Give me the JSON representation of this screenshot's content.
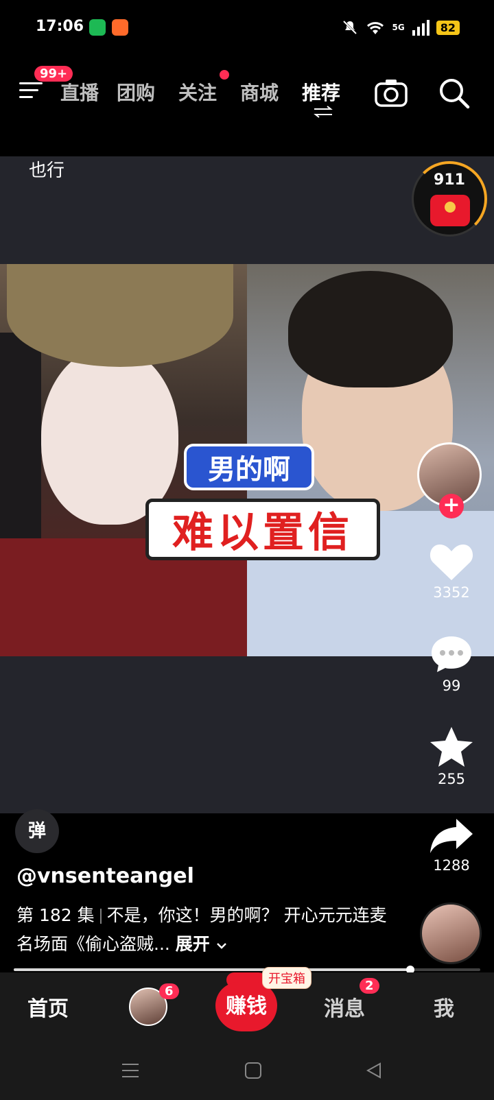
{
  "status_bar": {
    "time": "17:06",
    "network": "5G",
    "battery": "82"
  },
  "top_nav": {
    "menu_badge": "99+",
    "tabs": [
      {
        "label": "直播"
      },
      {
        "label": "团购"
      },
      {
        "label": "关注"
      },
      {
        "label": "商城"
      },
      {
        "label": "推荐"
      }
    ],
    "active_tab": "推荐"
  },
  "video": {
    "top_caption": "也行",
    "overlay_line1": "男的啊",
    "overlay_line2": "难以置信"
  },
  "red_packet": {
    "count": "911"
  },
  "actions": {
    "likes": "3352",
    "comments": "99",
    "favorites": "255",
    "shares": "1288"
  },
  "info": {
    "danmu_label": "弹",
    "author": "@vnsenteangel",
    "episode": "第 182 集",
    "description": "不是，你这！男的啊？ 开心元元连麦名场面《偷心盗贼...",
    "expand_label": "展开"
  },
  "progress": {
    "fraction": 0.85
  },
  "bottom_tabs": {
    "home": "首页",
    "friends_badge": "6",
    "earn": "赚钱",
    "treasure": "开宝箱",
    "messages": "消息",
    "messages_badge": "2",
    "me": "我"
  },
  "colors": {
    "accent_red": "#ff2d55",
    "video_bg": "#24252c"
  }
}
